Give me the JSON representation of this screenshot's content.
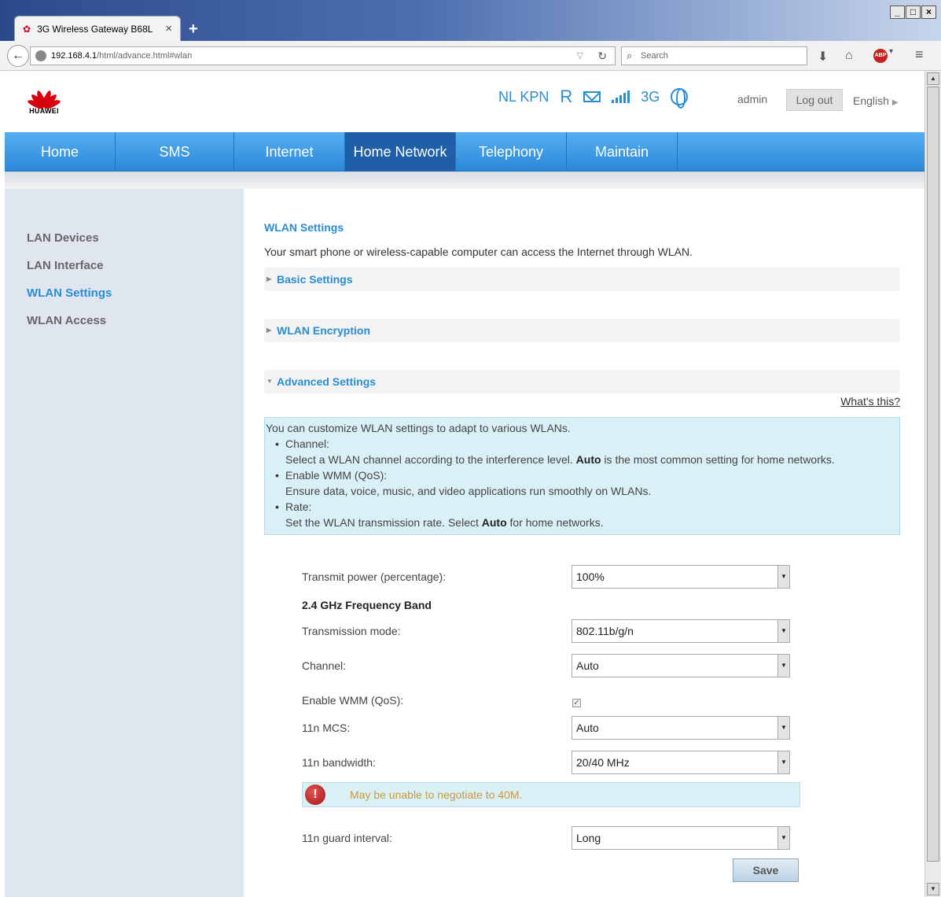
{
  "browser": {
    "tab_title": "3G Wireless Gateway B68L",
    "url_host": "192.168.4.1",
    "url_path": "/html/advance.html#wlan",
    "search_placeholder": "Search",
    "abp_label": "ABP"
  },
  "header": {
    "brand": "HUAWEI",
    "operator": "NL KPN",
    "roaming": "R",
    "network_type": "3G",
    "user": "admin",
    "logout_label": "Log out",
    "language": "English"
  },
  "nav": {
    "items": [
      "Home",
      "SMS",
      "Internet",
      "Home Network",
      "Telephony",
      "Maintain"
    ],
    "active": "Home Network"
  },
  "sidebar": {
    "items": [
      "LAN Devices",
      "LAN Interface",
      "WLAN Settings",
      "WLAN Access"
    ],
    "active": "WLAN Settings"
  },
  "main": {
    "title": "WLAN Settings",
    "intro": "Your smart phone or wireless-capable computer can access the Internet through WLAN.",
    "sections": [
      "Basic Settings",
      "WLAN Encryption",
      "Advanced Settings"
    ],
    "whats_this": "What's this?",
    "help": {
      "lead": "You can customize WLAN settings to adapt to various WLANs.",
      "channel_head": "Channel:",
      "channel_pre": "Select a WLAN channel according to the interference level.",
      "channel_bold": "Auto",
      "channel_post": "is the most common setting for home networks.",
      "wmm_head": "Enable WMM (QoS):",
      "wmm_text": "Ensure data, voice, music, and video applications run smoothly on WLANs.",
      "rate_head": "Rate:",
      "rate_pre": "Set the WLAN transmission rate. Select",
      "rate_bold": "Auto",
      "rate_post": "for home networks."
    },
    "form": {
      "transmit_power_label": "Transmit power (percentage):",
      "transmit_power_value": "100%",
      "band_heading": "2.4 GHz Frequency Band",
      "mode_label": "Transmission mode:",
      "mode_value": "802.11b/g/n",
      "channel_label": "Channel:",
      "channel_value": "Auto",
      "wmm_label": "Enable WMM (QoS):",
      "mcs_label": "11n MCS:",
      "mcs_value": "Auto",
      "bandwidth_label": "11n bandwidth:",
      "bandwidth_value": "20/40 MHz",
      "warning": "May be unable to negotiate to 40M.",
      "guard_label": "11n guard interval:",
      "guard_value": "Long",
      "save_label": "Save"
    }
  }
}
